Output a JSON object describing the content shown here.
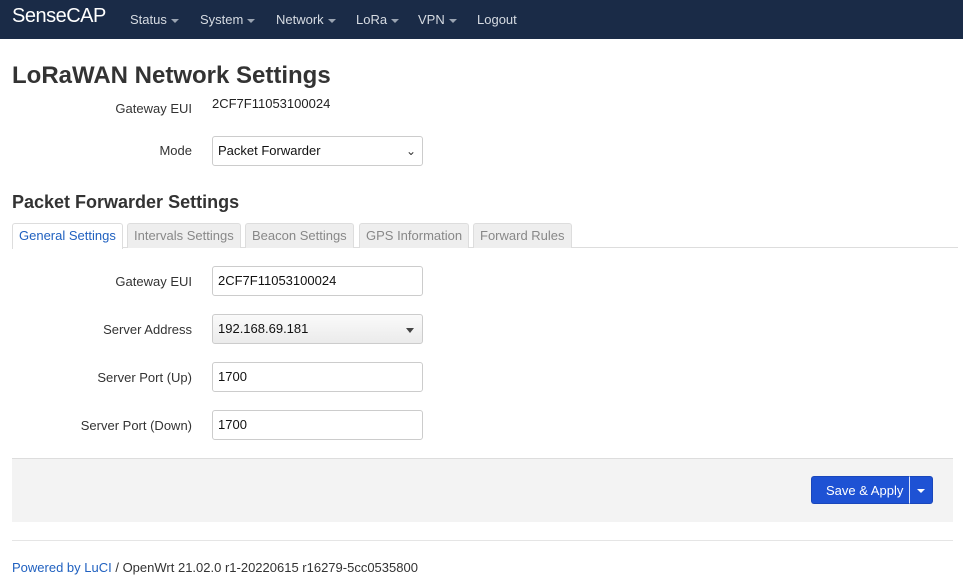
{
  "navbar": {
    "brand": "SenseCAP",
    "items": [
      {
        "label": "Status",
        "dropdown": true
      },
      {
        "label": "System",
        "dropdown": true
      },
      {
        "label": "Network",
        "dropdown": true
      },
      {
        "label": "LoRa",
        "dropdown": true
      },
      {
        "label": "VPN",
        "dropdown": true
      },
      {
        "label": "Logout",
        "dropdown": false
      }
    ]
  },
  "page": {
    "title": "LoRaWAN Network Settings",
    "gateway_eui_label": "Gateway EUI",
    "gateway_eui_value": "2CF7F11053100024",
    "mode_label": "Mode",
    "mode_value": "Packet Forwarder"
  },
  "section": {
    "title": "Packet Forwarder Settings",
    "tabs": [
      {
        "label": "General Settings",
        "active": true
      },
      {
        "label": "Intervals Settings",
        "active": false
      },
      {
        "label": "Beacon Settings",
        "active": false
      },
      {
        "label": "GPS Information",
        "active": false
      },
      {
        "label": "Forward Rules",
        "active": false
      }
    ],
    "fields": {
      "gateway_eui": {
        "label": "Gateway EUI",
        "value": "2CF7F11053100024"
      },
      "server_address": {
        "label": "Server Address",
        "value": "192.168.69.181"
      },
      "server_port_up": {
        "label": "Server Port (Up)",
        "value": "1700"
      },
      "server_port_down": {
        "label": "Server Port (Down)",
        "value": "1700"
      }
    }
  },
  "actions": {
    "save_apply_label": "Save & Apply"
  },
  "footer": {
    "link_text": "Powered by LuCI",
    "version_text": " / OpenWrt 21.02.0 r1-20220615 r16279-5cc0535800"
  },
  "colors": {
    "navbar_bg": "#1a2b47",
    "primary_button": "#1e52d4",
    "link": "#2061c0"
  }
}
